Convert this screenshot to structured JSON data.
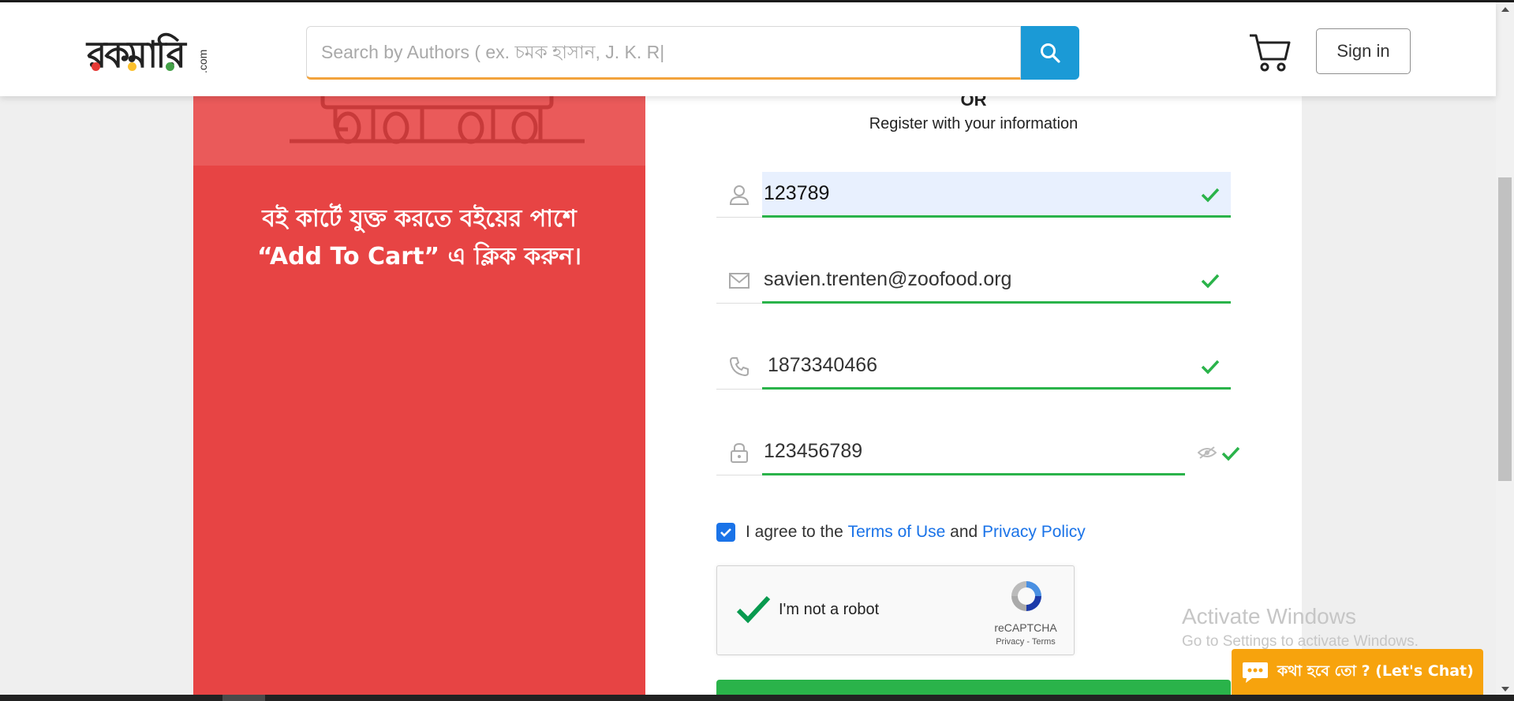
{
  "header": {
    "logo_text": "রকমারি",
    "logo_suffix": ".com",
    "search_placeholder": "Search by Authors ( ex. চমক হাসান, J. K. R|",
    "signin_label": "Sign in"
  },
  "promo": {
    "line1": "বই কার্টে যুক্ত করতে বইয়ের পাশে",
    "line2": "“Add To Cart” এ ক্লিক করুন।"
  },
  "form": {
    "or_label": "OR",
    "subtitle": "Register with your information",
    "name_value": "123789",
    "email_value": "savien.trenten@zoofood.org",
    "phone_value": "1873340466",
    "password_value": "123456789",
    "agree_prefix": "I agree to the",
    "terms_label": "Terms of Use",
    "and_label": "and",
    "privacy_label": "Privacy Policy",
    "recaptcha": {
      "label": "I'm not a robot",
      "brand": "reCAPTCHA",
      "privacy": "Privacy",
      "sep": "-",
      "terms": "Terms"
    }
  },
  "watermark": {
    "title": "Activate Windows",
    "subtitle": "Go to Settings to activate Windows."
  },
  "chat": {
    "label": "কথা হবে তো ? (Let's Chat)"
  },
  "colors": {
    "brand_red": "#e74444",
    "accent_blue": "#1b9ad6",
    "valid_green": "#2ab34a",
    "chat_orange": "#f7a30d"
  }
}
